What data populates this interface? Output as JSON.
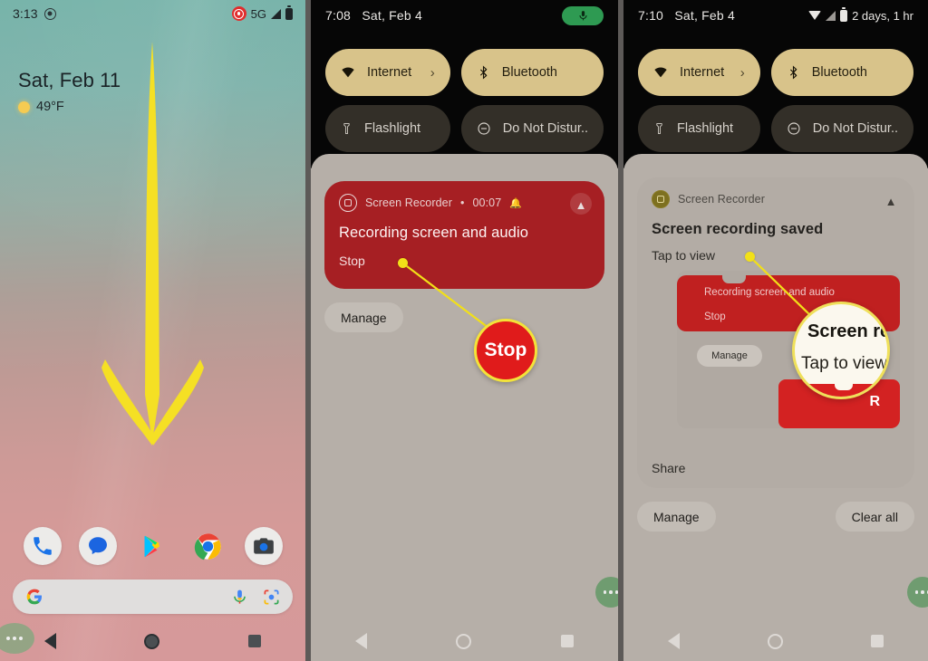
{
  "panel1": {
    "name": "home-screen-pull-down",
    "status_bar": {
      "time": "3:13",
      "network": "5G",
      "record_icon": "screen-record-icon",
      "signal_icon": "signal-icon",
      "battery_icon": "battery-icon"
    },
    "at_a_glance": {
      "date": "Sat, Feb 11",
      "temperature": "49°F",
      "weather_icon": "sunny-icon"
    },
    "dock": [
      {
        "label": "Phone",
        "icon": "phone-icon"
      },
      {
        "label": "Messages",
        "icon": "messages-icon"
      },
      {
        "label": "Play Store",
        "icon": "play-store-icon"
      },
      {
        "label": "Chrome",
        "icon": "chrome-icon"
      },
      {
        "label": "Camera",
        "icon": "camera-icon"
      }
    ],
    "search": {
      "logo": "google-g-icon",
      "mic": "microphone-icon",
      "lens": "google-lens-icon",
      "placeholder": ""
    },
    "gesture": {
      "annotation": "swipe-down-arrow",
      "color": "#f5e024"
    },
    "navbar": {
      "back": "back-nav-icon",
      "home": "home-nav-icon",
      "recents": "recents-nav-icon"
    }
  },
  "panel2": {
    "name": "quick-settings-recording",
    "status_bar": {
      "time": "7:08",
      "date": "Sat, Feb 4",
      "mic_pill_icon": "microphone-active-icon",
      "mic_pill_color": "#2e9a52"
    },
    "tiles": [
      {
        "label": "Internet",
        "icon": "wifi-icon",
        "state": "on",
        "chevron": "›"
      },
      {
        "label": "Bluetooth",
        "icon": "bluetooth-icon",
        "state": "on"
      },
      {
        "label": "Flashlight",
        "icon": "flashlight-icon",
        "state": "off"
      },
      {
        "label": "Do Not Distur..",
        "icon": "do-not-disturb-icon",
        "state": "off"
      }
    ],
    "notification": {
      "app": "Screen Recorder",
      "separator": "•",
      "timer": "00:07",
      "alert_icon": "silent-bell-icon",
      "title": "Recording screen and audio",
      "action": "Stop",
      "collapse_icon": "chevron-up-icon",
      "card_color": "#a61f23"
    },
    "manage_button": "Manage",
    "callout": {
      "label": "Stop",
      "dot_color": "#f2e018",
      "circle_fill": "#e01b1b",
      "ring": "#f3e23a"
    },
    "navbar": {
      "back": "back-nav-icon",
      "home": "home-nav-icon",
      "recents": "recents-nav-icon"
    }
  },
  "panel3": {
    "name": "quick-settings-recording-saved",
    "status_bar": {
      "time": "7:10",
      "date": "Sat, Feb 4",
      "wifi_icon": "wifi-icon",
      "signal_icon": "signal-icon",
      "battery_icon": "battery-icon",
      "battery_text": "2 days, 1 hr"
    },
    "tiles": [
      {
        "label": "Internet",
        "icon": "wifi-icon",
        "state": "on",
        "chevron": "›"
      },
      {
        "label": "Bluetooth",
        "icon": "bluetooth-icon",
        "state": "on"
      },
      {
        "label": "Flashlight",
        "icon": "flashlight-icon",
        "state": "off"
      },
      {
        "label": "Do Not Distur..",
        "icon": "do-not-disturb-icon",
        "state": "off"
      }
    ],
    "notification": {
      "app": "Screen Recorder",
      "title": "Screen recording saved",
      "subtitle": "Tap to view",
      "collapse_icon": "chevron-up-icon",
      "share_action": "Share",
      "thumbnail": {
        "line1": "Recording screen and audio",
        "line2": "Stop",
        "manage": "Manage",
        "letter": "R"
      }
    },
    "manage_button": "Manage",
    "clear_all_button": "Clear all",
    "callout": {
      "zoom_line_1": "Screen re",
      "zoom_line_2": "Tap to view",
      "dot_color": "#f2e018",
      "ring": "#efe05a"
    },
    "navbar": {
      "back": "back-nav-icon",
      "home": "home-nav-icon",
      "recents": "recents-nav-icon"
    }
  }
}
